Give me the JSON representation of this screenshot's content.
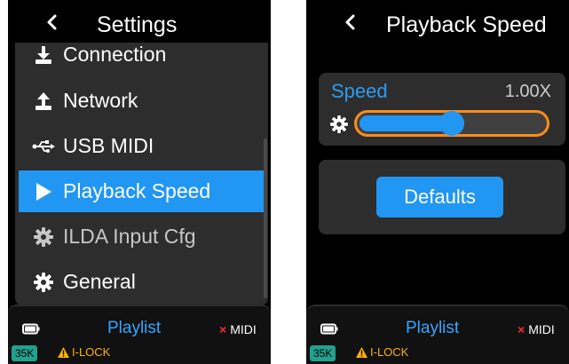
{
  "colors": {
    "accent": "#2196f3",
    "slider_border": "#ff8c1a",
    "badge": "#1fa28f",
    "warning": "#ffb300",
    "error": "#ff2a2a"
  },
  "left_screen": {
    "header": {
      "back_icon": "chevron-left-icon",
      "title": "Settings"
    },
    "menu": [
      {
        "label": "Connection",
        "icon": "download-icon",
        "selected": false
      },
      {
        "label": "Network",
        "icon": "upload-icon",
        "selected": false
      },
      {
        "label": "USB MIDI",
        "icon": "usb-icon",
        "selected": false
      },
      {
        "label": "Playback Speed",
        "icon": "play-icon",
        "selected": true
      },
      {
        "label": "ILDA Input Cfg",
        "icon": "gear-icon",
        "selected": false
      },
      {
        "label": "General",
        "icon": "gear-icon",
        "selected": false
      }
    ],
    "status": {
      "mode": "Playlist",
      "midi_label": "MIDI",
      "midi_mark": "×",
      "rate_badge": "35K",
      "lock_label": "I-LOCK"
    }
  },
  "right_screen": {
    "header": {
      "back_icon": "chevron-left-icon",
      "title": "Playback Speed"
    },
    "speed": {
      "label": "Speed",
      "value": "1.00X",
      "slider_level": 0.5
    },
    "defaults_button": "Defaults",
    "status": {
      "mode": "Playlist",
      "midi_label": "MIDI",
      "midi_mark": "×",
      "rate_badge": "35K",
      "lock_label": "I-LOCK"
    }
  }
}
